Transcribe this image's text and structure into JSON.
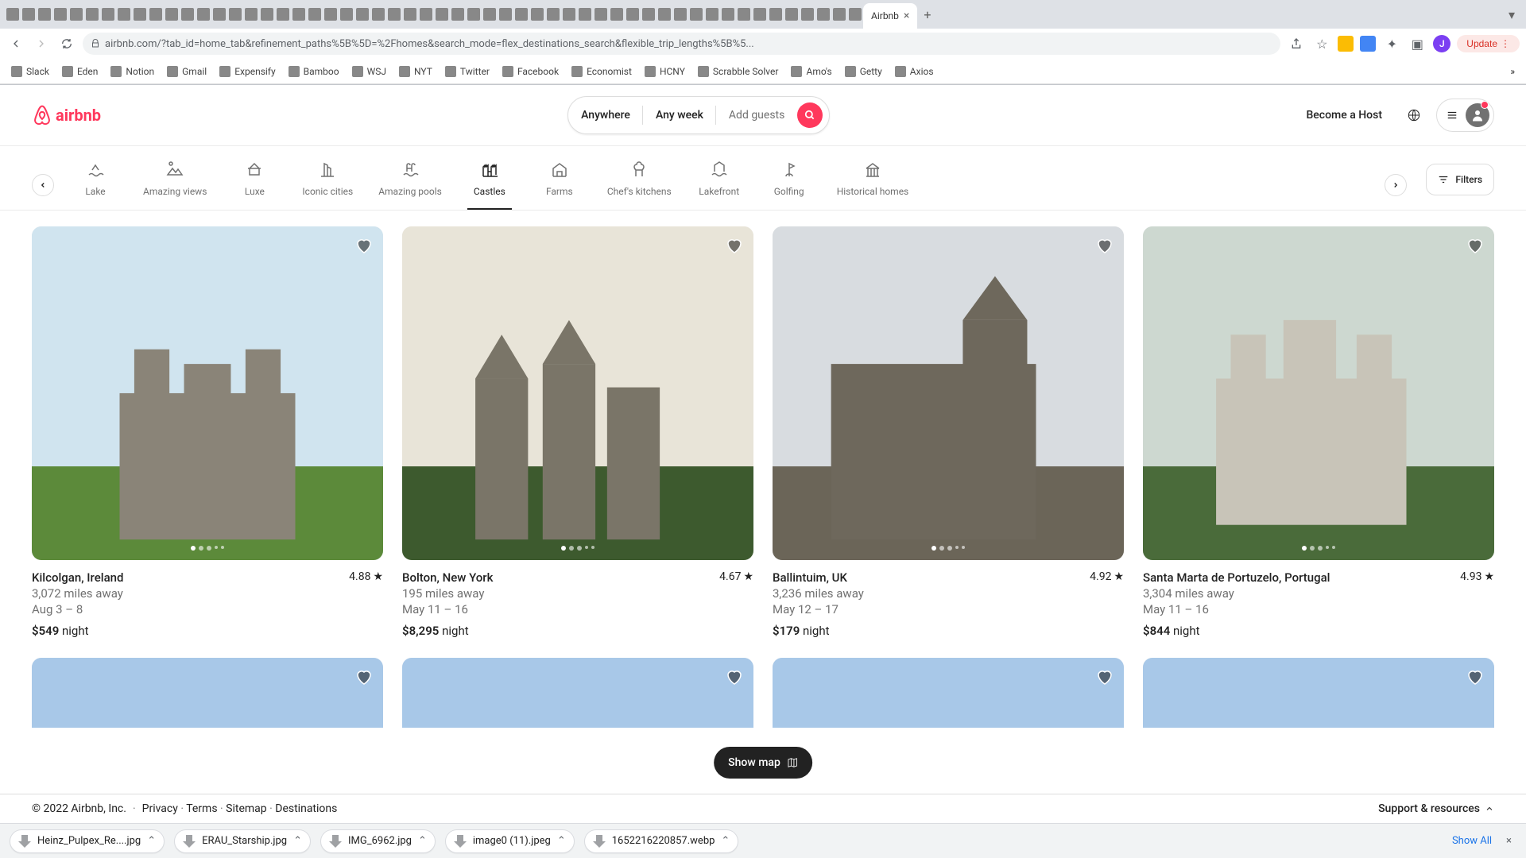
{
  "browser": {
    "active_tab_title": "Airbnb",
    "url": "airbnb.com/?tab_id=home_tab&refinement_paths%5B%5D=%2Fhomes&search_mode=flex_destinations_search&flexible_trip_lengths%5B%5...",
    "update_label": "Update",
    "avatar_initial": "J"
  },
  "bookmarks": [
    {
      "label": "Slack"
    },
    {
      "label": "Eden"
    },
    {
      "label": "Notion"
    },
    {
      "label": "Gmail"
    },
    {
      "label": "Expensify"
    },
    {
      "label": "Bamboo"
    },
    {
      "label": "WSJ"
    },
    {
      "label": "NYT"
    },
    {
      "label": "Twitter"
    },
    {
      "label": "Facebook"
    },
    {
      "label": "Economist"
    },
    {
      "label": "HCNY"
    },
    {
      "label": "Scrabble Solver"
    },
    {
      "label": "Amo's"
    },
    {
      "label": "Getty"
    },
    {
      "label": "Axios"
    }
  ],
  "header": {
    "logo_text": "airbnb",
    "host_label": "Become a Host"
  },
  "search": {
    "where": "Anywhere",
    "when": "Any week",
    "who": "Add guests"
  },
  "categories": [
    {
      "label": "Lake",
      "icon": "lake"
    },
    {
      "label": "Amazing views",
      "icon": "views"
    },
    {
      "label": "Luxe",
      "icon": "luxe"
    },
    {
      "label": "Iconic cities",
      "icon": "cities"
    },
    {
      "label": "Amazing pools",
      "icon": "pools"
    },
    {
      "label": "Castles",
      "icon": "castles",
      "active": true
    },
    {
      "label": "Farms",
      "icon": "farms"
    },
    {
      "label": "Chef's kitchens",
      "icon": "chef"
    },
    {
      "label": "Lakefront",
      "icon": "lakefront"
    },
    {
      "label": "Golfing",
      "icon": "golfing"
    },
    {
      "label": "Historical homes",
      "icon": "historical"
    }
  ],
  "filters_label": "Filters",
  "listings": [
    {
      "location": "Kilcolgan, Ireland",
      "distance": "3,072 miles away",
      "dates": "Aug 3 – 8",
      "price": "$549",
      "price_suffix": "night",
      "rating": "4.88",
      "img": {
        "sky": "#d0e4ef",
        "ground": "#5c8a3a",
        "stone": "#8a8478"
      }
    },
    {
      "location": "Bolton, New York",
      "distance": "195 miles away",
      "dates": "May 11 – 16",
      "price": "$8,295",
      "price_suffix": "night",
      "rating": "4.67",
      "img": {
        "sky": "#e8e4d8",
        "ground": "#3d5a2e",
        "stone": "#7a7568"
      }
    },
    {
      "location": "Ballintuim, UK",
      "distance": "3,236 miles away",
      "dates": "May 12 – 17",
      "price": "$179",
      "price_suffix": "night",
      "rating": "4.92",
      "img": {
        "sky": "#d8dce0",
        "ground": "#6b6558",
        "stone": "#6e685c"
      }
    },
    {
      "location": "Santa Marta de Portuzelo, Portugal",
      "distance": "3,304 miles away",
      "dates": "May 11 – 16",
      "price": "$844",
      "price_suffix": "night",
      "rating": "4.93",
      "img": {
        "sky": "#cdd8d0",
        "ground": "#4a6b3a",
        "stone": "#c8c4b8"
      }
    }
  ],
  "show_map_label": "Show map",
  "footer": {
    "copyright": "© 2022 Airbnb, Inc.",
    "links": [
      "Privacy",
      "Terms",
      "Sitemap",
      "Destinations"
    ],
    "support": "Support & resources"
  },
  "downloads": {
    "files": [
      "Heinz_Pulpex_Re....jpg",
      "ERAU_Starship.jpg",
      "IMG_6962.jpg",
      "image0 (11).jpeg",
      "1652216220857.webp"
    ],
    "show_all": "Show All"
  }
}
